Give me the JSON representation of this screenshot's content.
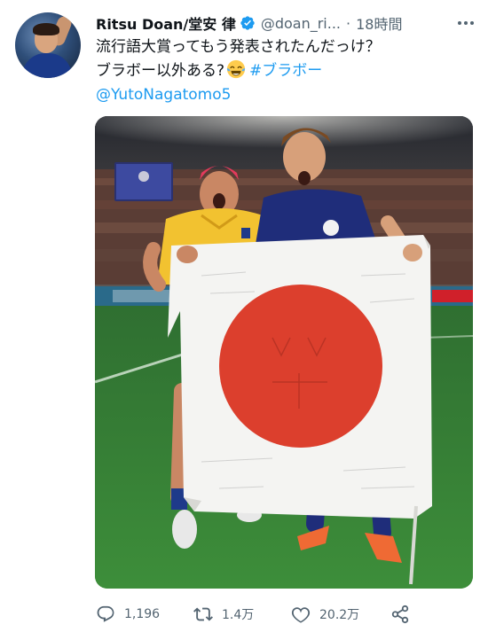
{
  "author": {
    "display_name": "Ritsu Doan/堂安 律",
    "handle": "@doan_ri...",
    "separator": "·",
    "timestamp": "18時間",
    "verified": true
  },
  "tweet": {
    "line1": "流行語大賞ってもう発表されたんだっけ？",
    "line2_text": "ブラボー以外ある?",
    "line2_emoji": "face-with-tears-of-joy",
    "hashtag": "#ブラボー",
    "mention": "@YutoNagatomo5"
  },
  "actions": {
    "reply_count": "1,196",
    "retweet_count": "1.4万",
    "like_count": "20.2万"
  },
  "colors": {
    "link": "#1d9bf0",
    "secondary": "#536471",
    "text": "#0f1419",
    "verified": "#1d9bf0"
  }
}
